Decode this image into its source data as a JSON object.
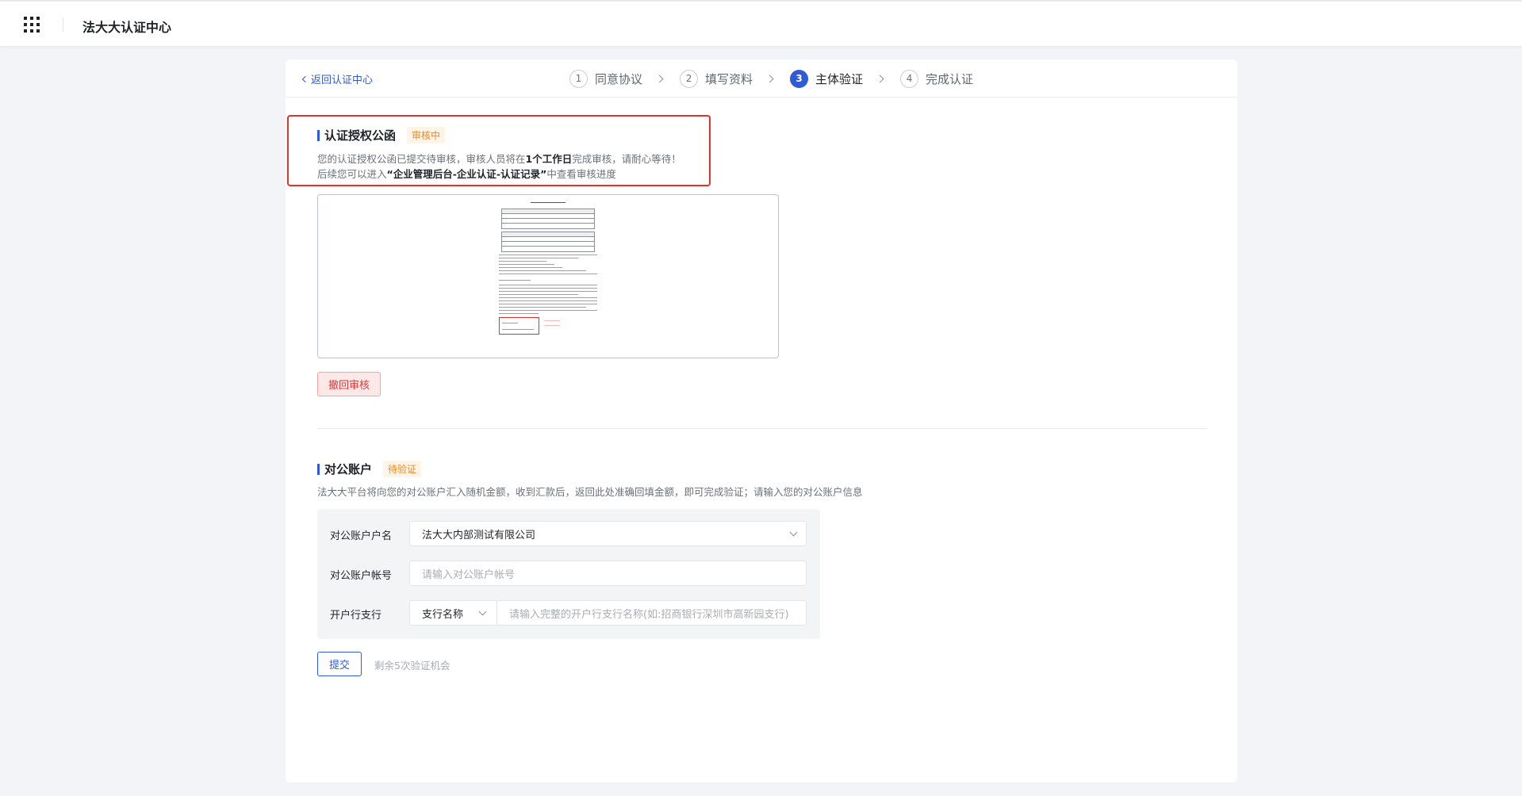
{
  "header": {
    "app_title": "法大大认证中心"
  },
  "nav": {
    "back_label": "返回认证中心"
  },
  "steps": [
    {
      "num": "1",
      "label": "同意协议"
    },
    {
      "num": "2",
      "label": "填写资料"
    },
    {
      "num": "3",
      "label": "主体验证"
    },
    {
      "num": "4",
      "label": "完成认证"
    }
  ],
  "auth_letter": {
    "title": "认证授权公函",
    "status": "审核中",
    "desc1_a": "您的认证授权公函已提交待审核，审核人员将在",
    "desc1_b": "1个工作日",
    "desc1_c": "完成审核，请耐心等待！",
    "desc2_a": "后续您可以进入",
    "desc2_b": "“企业管理后台-企业认证-认证记录”",
    "desc2_c": "中查看审核进度",
    "revoke_label": "撤回审核"
  },
  "bank": {
    "title": "对公账户",
    "status": "待验证",
    "desc": "法大大平台将向您的对公账户汇入随机金额，收到汇款后，返回此处准确回填金额，即可完成验证；请输入您的对公账户信息",
    "account_name_label": "对公账户户名",
    "account_name_value": "法大大内部测试有限公司",
    "account_no_label": "对公账户帐号",
    "account_no_placeholder": "请输入对公账户帐号",
    "branch_label": "开户行支行",
    "branch_select": "支行名称",
    "branch_placeholder": "请输入完整的开户行支行名称(如:招商银行深圳市高新园支行)",
    "submit_label": "提交",
    "remain_text": "剩余5次验证机会"
  },
  "colors": {
    "primary": "#2f5bd8",
    "warning": "#f08a24",
    "danger": "#e8302a"
  }
}
